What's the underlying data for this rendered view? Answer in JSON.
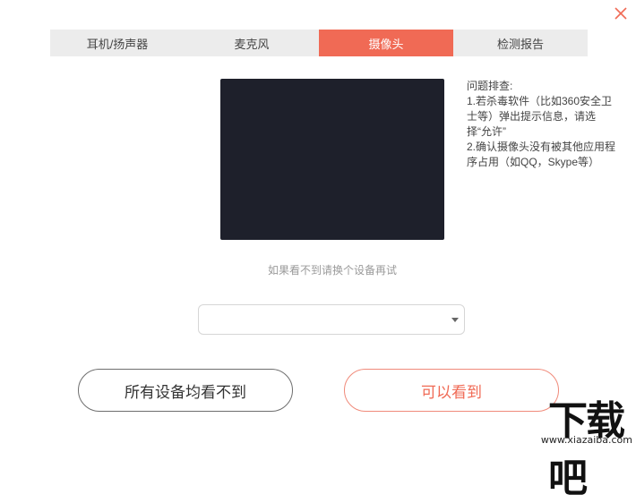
{
  "window": {
    "close_icon": "close-icon",
    "accent_color": "#f06a55"
  },
  "tabs": [
    {
      "label": "耳机/扬声器",
      "active": false
    },
    {
      "label": "麦克风",
      "active": false
    },
    {
      "label": "摄像头",
      "active": true
    },
    {
      "label": "检测报告",
      "active": false
    }
  ],
  "help": {
    "title": "问题排查:",
    "line1": "1.若杀毒软件（比如360安全卫士等）弹出提示信息，请选择“允许”",
    "line2": "2.确认摄像头没有被其他应用程序占用（如QQ，Skype等）"
  },
  "hint": "如果看不到请换个设备再试",
  "device_select": {
    "value": ""
  },
  "buttons": {
    "none_label": "所有设备均看不到",
    "ok_label": "可以看到"
  },
  "watermark": {
    "text": "下载吧",
    "url": "www.xiazaiba.com"
  }
}
